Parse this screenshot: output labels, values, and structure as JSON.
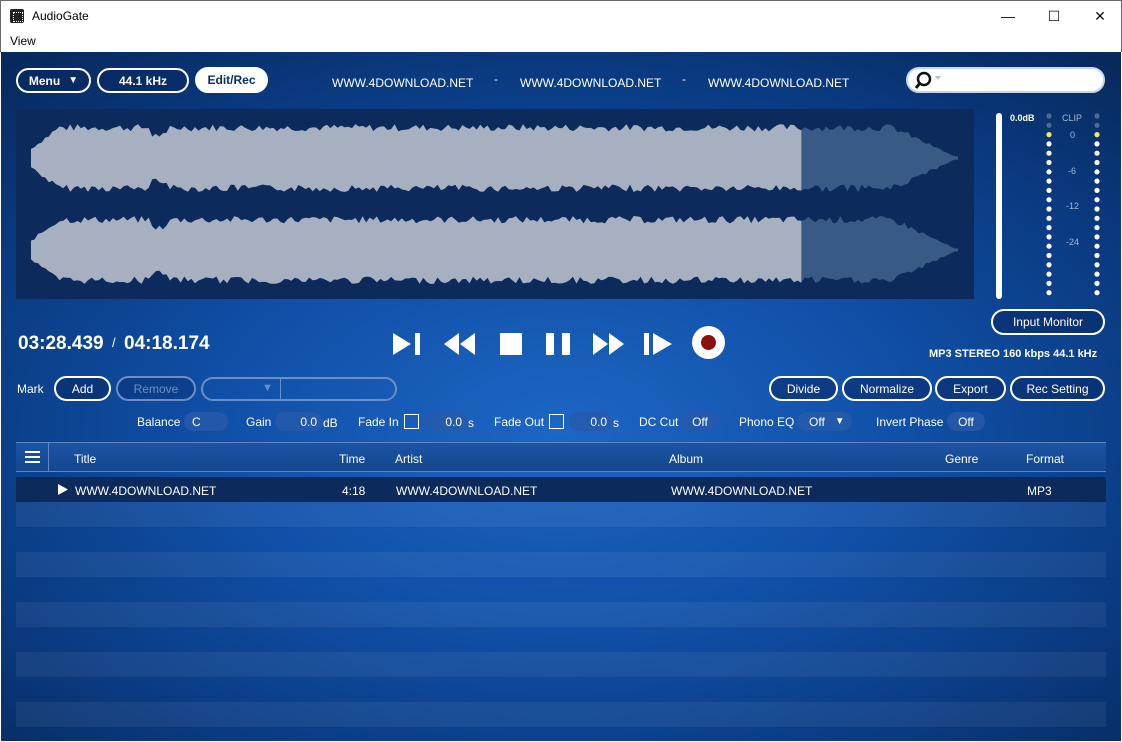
{
  "window": {
    "title": "AudioGate",
    "minimize": "—",
    "maximize": "☐",
    "close": "✕"
  },
  "menubar": {
    "view": "View"
  },
  "toolbar": {
    "menu_label": "Menu",
    "rate_label": "44.1 kHz",
    "editrec_label": "Edit/Rec",
    "links": [
      "WWW.4DOWNLOAD.NET",
      "-",
      "WWW.4DOWNLOAD.NET",
      "-",
      "WWW.4DOWNLOAD.NET"
    ]
  },
  "meters": {
    "peak": "0.0dB",
    "clip": "CLIP",
    "scale": [
      "0",
      "-6",
      "-12",
      "-24"
    ]
  },
  "transport": {
    "position": "03:28.439",
    "separator": "/",
    "duration": "04:18.174",
    "progress": 0.831
  },
  "input_monitor": "Input Monitor",
  "file_info": "MP3 STEREO 160 kbps 44.1 kHz",
  "marks": {
    "label": "Mark",
    "add": "Add",
    "remove": "Remove"
  },
  "edit_buttons": {
    "divide": "Divide",
    "normalize": "Normalize",
    "export": "Export",
    "rec_setting": "Rec Setting"
  },
  "controls": {
    "balance_label": "Balance",
    "balance_value": "C",
    "gain_label": "Gain",
    "gain_value": "0.0",
    "gain_unit": "dB",
    "fadein_label": "Fade In",
    "fadein_value": "0.0",
    "fadein_unit": "s",
    "fadeout_label": "Fade Out",
    "fadeout_value": "0.0",
    "fadeout_unit": "s",
    "dccut_label": "DC Cut",
    "dccut_value": "Off",
    "phono_label": "Phono EQ",
    "phono_value": "Off",
    "invert_label": "Invert Phase",
    "invert_value": "Off"
  },
  "table": {
    "headers": {
      "title": "Title",
      "time": "Time",
      "artist": "Artist",
      "album": "Album",
      "genre": "Genre",
      "format": "Format"
    },
    "rows": [
      {
        "title": "WWW.4DOWNLOAD.NET",
        "time": "4:18",
        "artist": "WWW.4DOWNLOAD.NET",
        "album": "WWW.4DOWNLOAD.NET",
        "genre": "",
        "format": "MP3"
      }
    ]
  },
  "colors": {
    "accent": "#1050a8",
    "waveform": "#a7b0c0",
    "waveform_dim": "#3a5a86",
    "record": "#8a1010"
  }
}
